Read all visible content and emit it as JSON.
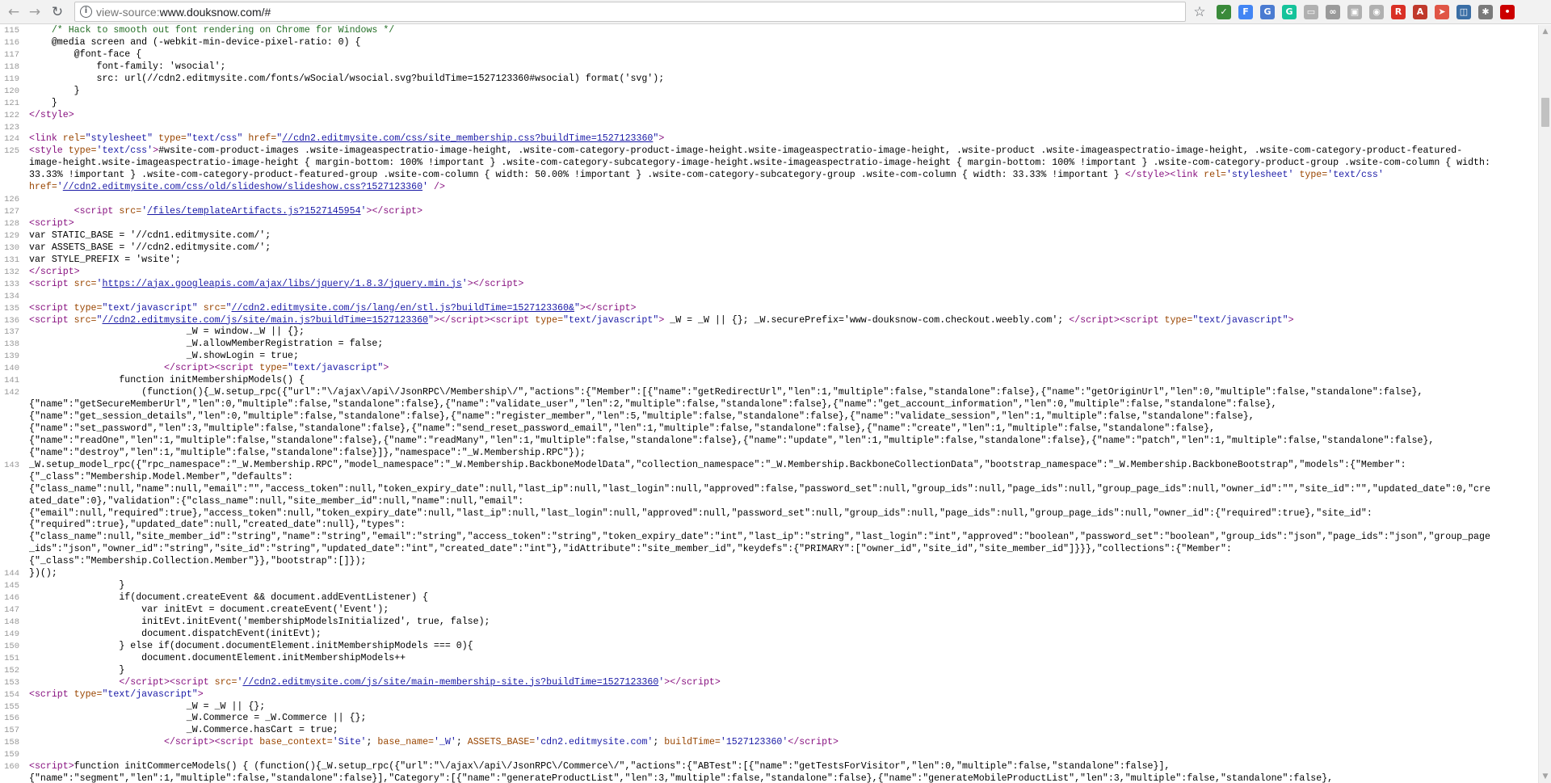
{
  "browser": {
    "back_glyph": "←",
    "forward_glyph": "→",
    "reload_glyph": "↻",
    "url_scheme": "view-source:",
    "url_host": "www.douksnow.com/#",
    "info_glyph": "i",
    "star_glyph": "☆",
    "extensions": [
      {
        "icon": "check-icon",
        "glyph": "✓",
        "color": "#3a8a3a"
      },
      {
        "icon": "F-icon",
        "glyph": "F",
        "color": "#4285f4"
      },
      {
        "icon": "translate-icon",
        "glyph": "G",
        "color": "#4a7bd1"
      },
      {
        "icon": "grammarly-icon",
        "glyph": "G",
        "color": "#15c39a"
      },
      {
        "icon": "image-icon",
        "glyph": "▭",
        "color": "#b0b0b0"
      },
      {
        "icon": "infinity-icon",
        "glyph": "∞",
        "color": "#9a9a9a"
      },
      {
        "icon": "cast-icon",
        "glyph": "▣",
        "color": "#b0b0b0"
      },
      {
        "icon": "camera-icon",
        "glyph": "◉",
        "color": "#b0b0b0"
      },
      {
        "icon": "red-ext-icon",
        "glyph": "R",
        "color": "#d93025"
      },
      {
        "icon": "pdf-icon",
        "glyph": "A",
        "color": "#c0392b"
      },
      {
        "icon": "arrow-ext-icon",
        "glyph": "➤",
        "color": "#e05545"
      },
      {
        "icon": "window-icon",
        "glyph": "◫",
        "color": "#3a6ea5"
      },
      {
        "icon": "gear-ext-icon",
        "glyph": "✱",
        "color": "#7a7a7a"
      },
      {
        "icon": "lastpass-icon",
        "glyph": "•",
        "color": "#cc0000"
      }
    ]
  },
  "source": {
    "lines": [
      {
        "n": "115",
        "html": "    <span class=\"comment\">/* Hack to smooth out font rendering on Chrome for Windows */</span>"
      },
      {
        "n": "116",
        "html": "    @media screen and (-webkit-min-device-pixel-ratio: 0) {"
      },
      {
        "n": "117",
        "html": "        @font-face {"
      },
      {
        "n": "118",
        "html": "            font-family: 'wsocial';"
      },
      {
        "n": "119",
        "html": "            src: url(//cdn2.editmysite.com/fonts/wSocial/wsocial.svg?buildTime=1527123360#wsocial) format('svg');"
      },
      {
        "n": "120",
        "html": "        }"
      },
      {
        "n": "121",
        "html": "    }"
      },
      {
        "n": "122",
        "html": "<span class=\"tag\">&lt;/style&gt;</span>"
      },
      {
        "n": "123",
        "html": ""
      },
      {
        "n": "124",
        "html": "<span class=\"tag\">&lt;link</span> <span class=\"attr\">rel=</span><span class=\"val\">\"stylesheet\"</span> <span class=\"attr\">type=</span><span class=\"val\">\"text/css\"</span> <span class=\"attr\">href=</span><span class=\"val\">\"</span><span class=\"link\">//cdn2.editmysite.com/css/site_membership.css?buildTime=1527123360</span><span class=\"val\">\"</span><span class=\"tag\">&gt;</span>"
      },
      {
        "n": "125",
        "html": "<span class=\"tag\">&lt;style</span> <span class=\"attr\">type=</span><span class=\"val\">'text/css'</span><span class=\"tag\">&gt;</span>#wsite-com-product-images .wsite-imageaspectratio-image-height, .wsite-com-category-product-image-height.wsite-imageaspectratio-image-height, .wsite-product .wsite-imageaspectratio-image-height, .wsite-com-category-product-featured-"
      },
      {
        "n": "",
        "html": "image-height.wsite-imageaspectratio-image-height { margin-bottom: 100% !important } .wsite-com-category-subcategory-image-height.wsite-imageaspectratio-image-height { margin-bottom: 100% !important } .wsite-com-category-product-group .wsite-com-column { width:"
      },
      {
        "n": "",
        "html": "33.33% !important } .wsite-com-category-product-featured-group .wsite-com-column { width: 50.00% !important } .wsite-com-category-subcategory-group .wsite-com-column { width: 33.33% !important } <span class=\"tag\">&lt;/style&gt;&lt;link</span> <span class=\"attr\">rel=</span><span class=\"val\">'stylesheet'</span> <span class=\"attr\">type=</span><span class=\"val\">'text/css'</span>"
      },
      {
        "n": "",
        "html": "<span class=\"attr\">href=</span><span class=\"val\">'</span><span class=\"link\">//cdn2.editmysite.com/css/old/slideshow/slideshow.css?1527123360</span><span class=\"val\">'</span> <span class=\"tag\">/&gt;</span>"
      },
      {
        "n": "126",
        "html": ""
      },
      {
        "n": "127",
        "html": "        <span class=\"tag\">&lt;script</span> <span class=\"attr\">src=</span><span class=\"val\">'</span><span class=\"link\">/files/templateArtifacts.js?1527145954</span><span class=\"val\">'</span><span class=\"tag\">&gt;&lt;/script&gt;</span>"
      },
      {
        "n": "128",
        "html": "<span class=\"tag\">&lt;script&gt;</span>"
      },
      {
        "n": "129",
        "html": "var STATIC_BASE = '//cdn1.editmysite.com/';"
      },
      {
        "n": "130",
        "html": "var ASSETS_BASE = '//cdn2.editmysite.com/';"
      },
      {
        "n": "131",
        "html": "var STYLE_PREFIX = 'wsite';"
      },
      {
        "n": "132",
        "html": "<span class=\"tag\">&lt;/script&gt;</span>"
      },
      {
        "n": "133",
        "html": "<span class=\"tag\">&lt;script</span> <span class=\"attr\">src=</span><span class=\"val\">'</span><span class=\"link\">https://ajax.googleapis.com/ajax/libs/jquery/1.8.3/jquery.min.js</span><span class=\"val\">'</span><span class=\"tag\">&gt;&lt;/script&gt;</span>"
      },
      {
        "n": "134",
        "html": ""
      },
      {
        "n": "135",
        "html": "<span class=\"tag\">&lt;script</span> <span class=\"attr\">type=</span><span class=\"val\">\"text/javascript\"</span> <span class=\"attr\">src=</span><span class=\"val\">\"</span><span class=\"link\">//cdn2.editmysite.com/js/lang/en/stl.js?buildTime=1527123360&amp;</span><span class=\"val\">\"</span><span class=\"tag\">&gt;&lt;/script&gt;</span>"
      },
      {
        "n": "136",
        "html": "<span class=\"tag\">&lt;script</span> <span class=\"attr\">src=</span><span class=\"val\">\"</span><span class=\"link\">//cdn2.editmysite.com/js/site/main.js?buildTime=1527123360</span><span class=\"val\">\"</span><span class=\"tag\">&gt;&lt;/script&gt;&lt;script</span> <span class=\"attr\">type=</span><span class=\"val\">\"text/javascript\"</span><span class=\"tag\">&gt;</span> _W = _W || {}; _W.securePrefix='www-douksnow-com.checkout.weebly.com'; <span class=\"tag\">&lt;/script&gt;&lt;script</span> <span class=\"attr\">type=</span><span class=\"val\">\"text/javascript\"</span><span class=\"tag\">&gt;</span>"
      },
      {
        "n": "137",
        "html": "                            _W = window._W || {};"
      },
      {
        "n": "138",
        "html": "                            _W.allowMemberRegistration = false;"
      },
      {
        "n": "139",
        "html": "                            _W.showLogin = true;"
      },
      {
        "n": "140",
        "html": "                        <span class=\"tag\">&lt;/script&gt;&lt;script</span> <span class=\"attr\">type=</span><span class=\"val\">\"text/javascript\"</span><span class=\"tag\">&gt;</span>"
      },
      {
        "n": "141",
        "html": "                function initMembershipModels() {"
      },
      {
        "n": "142",
        "html": "                    (function(){_W.setup_rpc({\"url\":\"\\/ajax\\/api\\/JsonRPC\\/Membership\\/\",\"actions\":{\"Member\":[{\"name\":\"getRedirectUrl\",\"len\":1,\"multiple\":false,\"standalone\":false},{\"name\":\"getOriginUrl\",\"len\":0,\"multiple\":false,\"standalone\":false},"
      },
      {
        "n": "",
        "html": "{\"name\":\"getSecureMemberUrl\",\"len\":0,\"multiple\":false,\"standalone\":false},{\"name\":\"validate_user\",\"len\":2,\"multiple\":false,\"standalone\":false},{\"name\":\"get_account_information\",\"len\":0,\"multiple\":false,\"standalone\":false},"
      },
      {
        "n": "",
        "html": "{\"name\":\"get_session_details\",\"len\":0,\"multiple\":false,\"standalone\":false},{\"name\":\"register_member\",\"len\":5,\"multiple\":false,\"standalone\":false},{\"name\":\"validate_session\",\"len\":1,\"multiple\":false,\"standalone\":false},"
      },
      {
        "n": "",
        "html": "{\"name\":\"set_password\",\"len\":3,\"multiple\":false,\"standalone\":false},{\"name\":\"send_reset_password_email\",\"len\":1,\"multiple\":false,\"standalone\":false},{\"name\":\"create\",\"len\":1,\"multiple\":false,\"standalone\":false},"
      },
      {
        "n": "",
        "html": "{\"name\":\"readOne\",\"len\":1,\"multiple\":false,\"standalone\":false},{\"name\":\"readMany\",\"len\":1,\"multiple\":false,\"standalone\":false},{\"name\":\"update\",\"len\":1,\"multiple\":false,\"standalone\":false},{\"name\":\"patch\",\"len\":1,\"multiple\":false,\"standalone\":false},"
      },
      {
        "n": "",
        "html": "{\"name\":\"destroy\",\"len\":1,\"multiple\":false,\"standalone\":false}]},\"namespace\":\"_W.Membership.RPC\"});"
      },
      {
        "n": "143",
        "html": "_W.setup_model_rpc({\"rpc_namespace\":\"_W.Membership.RPC\",\"model_namespace\":\"_W.Membership.BackboneModelData\",\"collection_namespace\":\"_W.Membership.BackboneCollectionData\",\"bootstrap_namespace\":\"_W.Membership.BackboneBootstrap\",\"models\":{\"Member\":"
      },
      {
        "n": "",
        "html": "{\"_class\":\"Membership.Model.Member\",\"defaults\":"
      },
      {
        "n": "",
        "html": "{\"class_name\":null,\"name\":null,\"email\":\"\",\"access_token\":null,\"token_expiry_date\":null,\"last_ip\":null,\"last_login\":null,\"approved\":false,\"password_set\":null,\"group_ids\":null,\"page_ids\":null,\"group_page_ids\":null,\"owner_id\":\"\",\"site_id\":\"\",\"updated_date\":0,\"cre"
      },
      {
        "n": "",
        "html": "ated_date\":0},\"validation\":{\"class_name\":null,\"site_member_id\":null,\"name\":null,\"email\":"
      },
      {
        "n": "",
        "html": "{\"email\":null,\"required\":true},\"access_token\":null,\"token_expiry_date\":null,\"last_ip\":null,\"last_login\":null,\"approved\":null,\"password_set\":null,\"group_ids\":null,\"page_ids\":null,\"group_page_ids\":null,\"owner_id\":{\"required\":true},\"site_id\":"
      },
      {
        "n": "",
        "html": "{\"required\":true},\"updated_date\":null,\"created_date\":null},\"types\":"
      },
      {
        "n": "",
        "html": "{\"class_name\":null,\"site_member_id\":\"string\",\"name\":\"string\",\"email\":\"string\",\"access_token\":\"string\",\"token_expiry_date\":\"int\",\"last_ip\":\"string\",\"last_login\":\"int\",\"approved\":\"boolean\",\"password_set\":\"boolean\",\"group_ids\":\"json\",\"page_ids\":\"json\",\"group_page"
      },
      {
        "n": "",
        "html": "_ids\":\"json\",\"owner_id\":\"string\",\"site_id\":\"string\",\"updated_date\":\"int\",\"created_date\":\"int\"},\"idAttribute\":\"site_member_id\",\"keydefs\":{\"PRIMARY\":[\"owner_id\",\"site_id\",\"site_member_id\"]}}},\"collections\":{\"Member\":"
      },
      {
        "n": "",
        "html": "{\"_class\":\"Membership.Collection.Member\"}},\"bootstrap\":[]});"
      },
      {
        "n": "144",
        "html": "})();"
      },
      {
        "n": "145",
        "html": "                }"
      },
      {
        "n": "146",
        "html": "                if(document.createEvent &amp;&amp; document.addEventListener) {"
      },
      {
        "n": "147",
        "html": "                    var initEvt = document.createEvent('Event');"
      },
      {
        "n": "148",
        "html": "                    initEvt.initEvent('membershipModelsInitialized', true, false);"
      },
      {
        "n": "149",
        "html": "                    document.dispatchEvent(initEvt);"
      },
      {
        "n": "150",
        "html": "                } else if(document.documentElement.initMembershipModels === 0){"
      },
      {
        "n": "151",
        "html": "                    document.documentElement.initMembershipModels++"
      },
      {
        "n": "152",
        "html": "                }"
      },
      {
        "n": "153",
        "html": "                <span class=\"tag\">&lt;/script&gt;&lt;script</span> <span class=\"attr\">src=</span><span class=\"val\">'</span><span class=\"link\">//cdn2.editmysite.com/js/site/main-membership-site.js?buildTime=1527123360</span><span class=\"val\">'</span><span class=\"tag\">&gt;&lt;/script&gt;</span>"
      },
      {
        "n": "154",
        "html": "<span class=\"tag\">&lt;script</span> <span class=\"attr\">type=</span><span class=\"val\">\"text/javascript\"</span><span class=\"tag\">&gt;</span>"
      },
      {
        "n": "155",
        "html": "                            _W = _W || {};"
      },
      {
        "n": "156",
        "html": "                            _W.Commerce = _W.Commerce || {};"
      },
      {
        "n": "157",
        "html": "                            _W.Commerce.hasCart = true;"
      },
      {
        "n": "158",
        "html": "                        <span class=\"tag\">&lt;/script&gt;&lt;script</span> <span class=\"attr\">base_context=</span><span class=\"val\">'Site'</span>; <span class=\"attr\">base_name=</span><span class=\"val\">'_W'</span>; <span class=\"attr\">ASSETS_BASE=</span><span class=\"val\">'cdn2.editmysite.com'</span>; <span class=\"attr\">buildTime=</span><span class=\"val\">'1527123360'</span><span class=\"tag\">&lt;/script&gt;</span>"
      },
      {
        "n": "159",
        "html": ""
      },
      {
        "n": "160",
        "html": "<span class=\"tag\">&lt;script&gt;</span>function initCommerceModels() { (function(){_W.setup_rpc({\"url\":\"\\/ajax\\/api\\/JsonRPC\\/Commerce\\/\",\"actions\":{\"ABTest\":[{\"name\":\"getTestsForVisitor\",\"len\":0,\"multiple\":false,\"standalone\":false}],"
      },
      {
        "n": "",
        "html": "{\"name\":\"segment\",\"len\":1,\"multiple\":false,\"standalone\":false}],\"Category\":[{\"name\":\"generateProductList\",\"len\":3,\"multiple\":false,\"standalone\":false},{\"name\":\"generateMobileProductList\",\"len\":3,\"multiple\":false,\"standalone\":false},"
      }
    ]
  },
  "scrollbar": {
    "up_glyph": "▲",
    "down_glyph": "▼"
  }
}
